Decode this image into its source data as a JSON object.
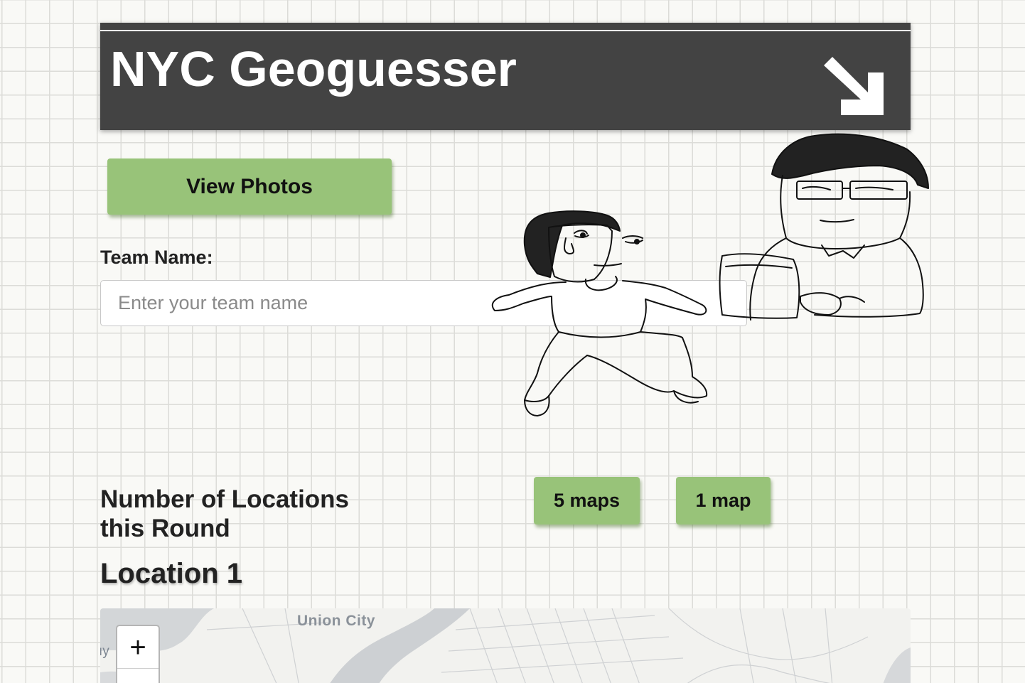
{
  "header": {
    "title": "NYC Geoguesser",
    "arrow_icon": "arrow-down-right-icon"
  },
  "view_photos_button": "View Photos",
  "team": {
    "label": "Team Name:",
    "placeholder": "Enter your team name",
    "value": ""
  },
  "locations": {
    "label": "Number of Locations this Round",
    "option_5": "5 maps",
    "option_1": "1 map"
  },
  "location_title": "Location 1",
  "map": {
    "place_label": "Union City",
    "edge_label": "ıy",
    "zoom_in": "+"
  },
  "colors": {
    "header_bg": "#434343",
    "button_green": "#98c379",
    "page_bg": "#f9f9f6",
    "grid_line": "#dcdcd8"
  }
}
